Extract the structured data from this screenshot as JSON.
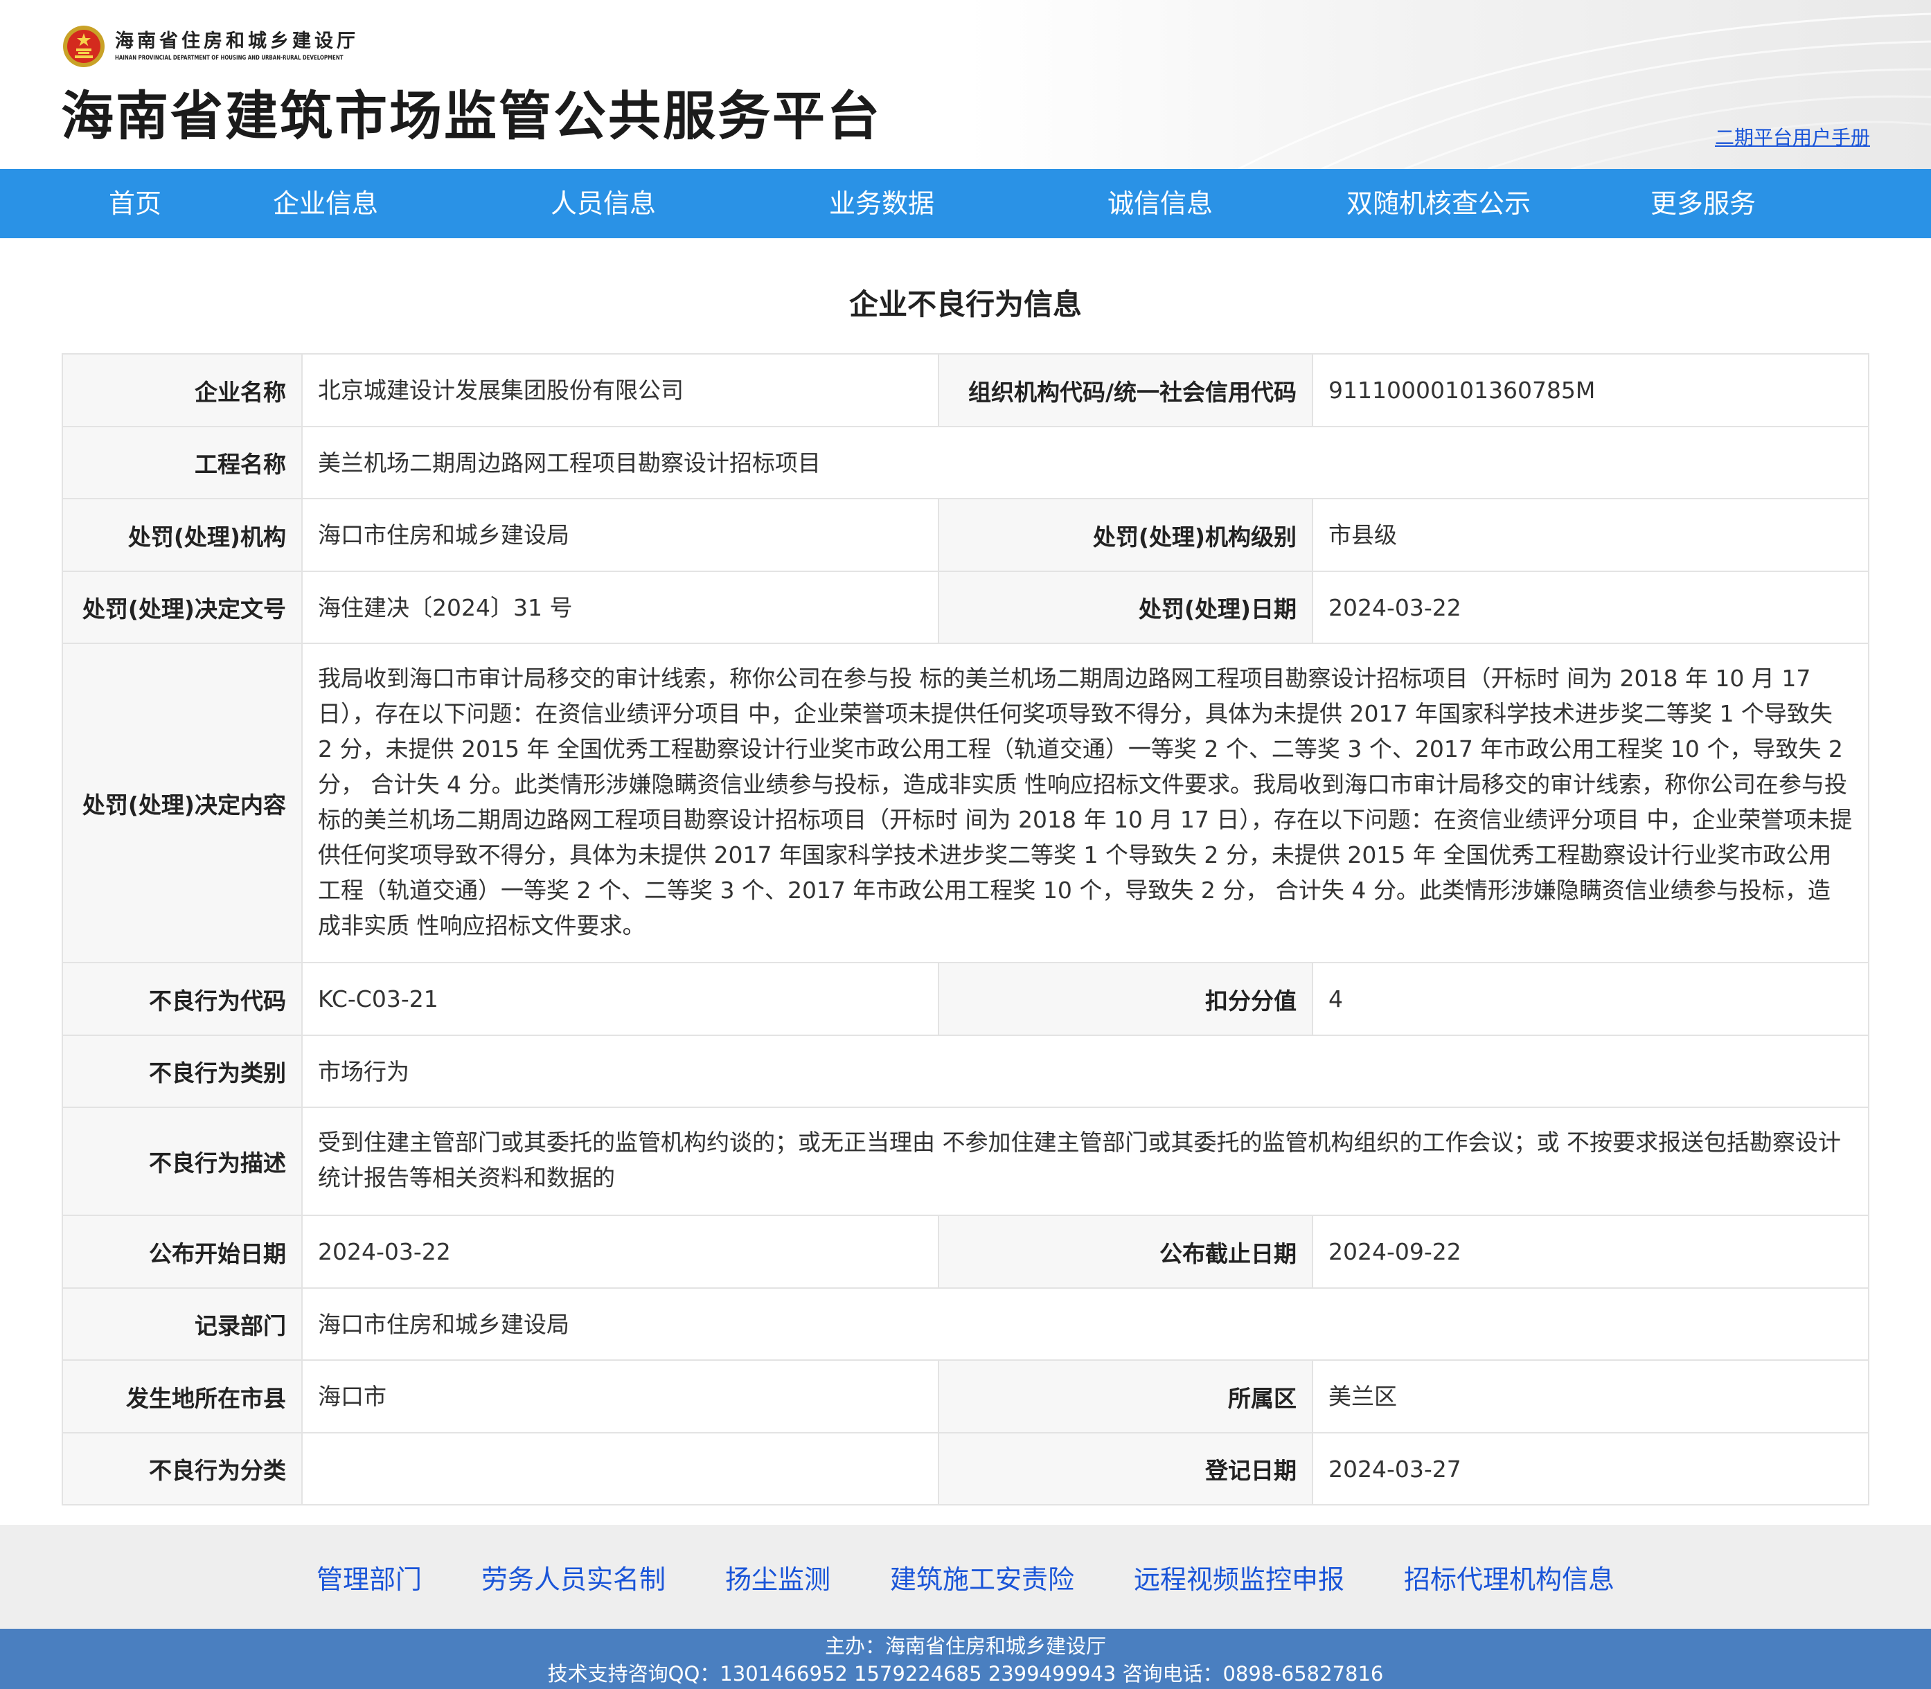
{
  "header": {
    "dept_name_cn": "海南省住房和城乡建设厅",
    "dept_name_en": "HAINAN PROVINCIAL DEPARTMENT OF HOUSING AND URBAN-RURAL DEVELOPMENT",
    "site_title": "海南省建筑市场监管公共服务平台",
    "manual_link": "二期平台用户手册"
  },
  "nav": {
    "items": [
      "首页",
      "企业信息",
      "人员信息",
      "业务数据",
      "诚信信息",
      "双随机核查公示",
      "更多服务"
    ]
  },
  "page_title": "企业不良行为信息",
  "record": {
    "company_name_label": "企业名称",
    "company_name": "北京城建设计发展集团股份有限公司",
    "org_code_label": "组织机构代码/统一社会信用代码",
    "org_code": "91110000101360785M",
    "project_name_label": "工程名称",
    "project_name": "美兰机场二期周边路网工程项目勘察设计招标项目",
    "penalty_org_label": "处罚(处理)机构",
    "penalty_org": "海口市住房和城乡建设局",
    "penalty_org_level_label": "处罚(处理)机构级别",
    "penalty_org_level": "市县级",
    "decision_doc_label": "处罚(处理)决定文号",
    "decision_doc": "海住建决〔2024〕31 号",
    "penalty_date_label": "处罚(处理)日期",
    "penalty_date": "2024-03-22",
    "decision_content_label": "处罚(处理)决定内容",
    "decision_content": "我局收到海口市审计局移交的审计线索，称你公司在参与投 标的美兰机场二期周边路网工程项目勘察设计招标项目（开标时 间为 2018 年 10 月 17 日），存在以下问题：在资信业绩评分项目 中，企业荣誉项未提供任何奖项导致不得分，具体为未提供 2017 年国家科学技术进步奖二等奖 1 个导致失 2 分，未提供 2015 年 全国优秀工程勘察设计行业奖市政公用工程（轨道交通）一等奖 2 个、二等奖 3 个、2017 年市政公用工程奖 10 个，导致失 2 分， 合计失 4 分。此类情形涉嫌隐瞒资信业绩参与投标，造成非实质 性响应招标文件要求。我局收到海口市审计局移交的审计线索，称你公司在参与投 标的美兰机场二期周边路网工程项目勘察设计招标项目（开标时 间为 2018 年 10 月 17 日），存在以下问题：在资信业绩评分项目 中，企业荣誉项未提供任何奖项导致不得分，具体为未提供 2017 年国家科学技术进步奖二等奖 1 个导致失 2 分，未提供 2015 年 全国优秀工程勘察设计行业奖市政公用工程（轨道交通）一等奖 2 个、二等奖 3 个、2017 年市政公用工程奖 10 个，导致失 2 分， 合计失 4 分。此类情形涉嫌隐瞒资信业绩参与投标，造成非实质 性响应招标文件要求。",
    "behavior_code_label": "不良行为代码",
    "behavior_code": "KC-C03-21",
    "deduction_label": "扣分分值",
    "deduction": "4",
    "behavior_type_label": "不良行为类别",
    "behavior_type": "市场行为",
    "behavior_desc_label": "不良行为描述",
    "behavior_desc": "受到住建主管部门或其委托的监管机构约谈的；或无正当理由 不参加住建主管部门或其委托的监管机构组织的工作会议；或 不按要求报送包括勘察设计统计报告等相关资料和数据的",
    "publish_start_label": "公布开始日期",
    "publish_start": "2024-03-22",
    "publish_end_label": "公布截止日期",
    "publish_end": "2024-09-22",
    "record_dept_label": "记录部门",
    "record_dept": "海口市住房和城乡建设局",
    "city_label": "发生地所在市县",
    "city": "海口市",
    "district_label": "所属区",
    "district": "美兰区",
    "behavior_class_label": "不良行为分类",
    "behavior_class": "",
    "register_date_label": "登记日期",
    "register_date": "2024-03-27"
  },
  "footer_links": [
    "管理部门",
    "劳务人员实名制",
    "扬尘监测",
    "建筑施工安责险",
    "远程视频监控申报",
    "招标代理机构信息"
  ],
  "copyright": {
    "sponsor": "主办：海南省住房和城乡建设厅",
    "support": "技术支持咨询QQ：1301466952 1579224685 2399499943 咨询电话：0898-65827816"
  },
  "colors": {
    "nav_bg": "#2a92e6",
    "link": "#1a55d8",
    "footer_bg": "#4a7fc0",
    "label_bg": "#f7f7f7",
    "border": "#e3e3e3"
  }
}
